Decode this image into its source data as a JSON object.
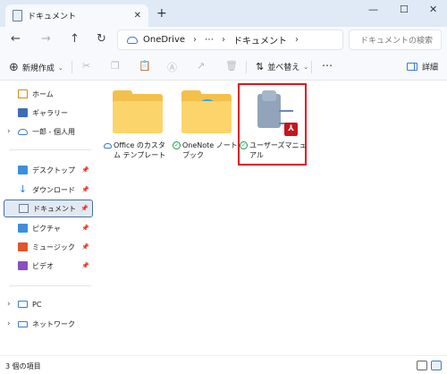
{
  "window": {
    "tab_title": "ドキュメント",
    "tab_close": "✕",
    "new_tab": "+",
    "minimize": "—",
    "maximize": "☐",
    "close": "✕"
  },
  "nav": {
    "back": "←",
    "forward": "→",
    "up": "↑",
    "refresh": "↻",
    "address": {
      "root": "OneDrive",
      "ellipsis": "⋯",
      "folder": "ドキュメント",
      "sep": "›"
    },
    "search_placeholder": "ドキュメントの検索"
  },
  "toolbar": {
    "new_label": "新規作成",
    "new_plus": "⊕",
    "sort_label": "並べ替え",
    "sort_icon": "⇅",
    "more": "⋯",
    "details_label": "詳細",
    "chevron": "⌄",
    "icons": [
      "cut-icon",
      "copy-icon",
      "paste-icon",
      "rename-icon",
      "share-icon",
      "delete-icon"
    ],
    "icon_glyphs": [
      "✂",
      "❐",
      "📋",
      "Ⓐ",
      "↗",
      "🗑"
    ]
  },
  "sidebar": {
    "pin": "📌",
    "caret": "›",
    "items": [
      {
        "label": "ホーム",
        "icon": "home-icon"
      },
      {
        "label": "ギャラリー",
        "icon": "gallery-icon"
      },
      {
        "label": "一郎 - 個人用",
        "icon": "onedrive-icon"
      },
      {
        "label": "デスクトップ",
        "icon": "desktop-icon"
      },
      {
        "label": "ダウンロード",
        "icon": "download-icon"
      },
      {
        "label": "ドキュメント",
        "icon": "documents-icon"
      },
      {
        "label": "ピクチャ",
        "icon": "pictures-icon"
      },
      {
        "label": "ミュージック",
        "icon": "music-icon"
      },
      {
        "label": "ビデオ",
        "icon": "videos-icon"
      },
      {
        "label": "PC",
        "icon": "pc-icon"
      },
      {
        "label": "ネットワーク",
        "icon": "network-icon"
      }
    ]
  },
  "files": [
    {
      "name": "Office のカスタム テンプレート",
      "status": "cloud"
    },
    {
      "name": "OneNote ノートブック",
      "status": "synced"
    },
    {
      "name": "ユーザーズマニュアル",
      "status": "synced",
      "badge": "PDF"
    }
  ],
  "statusbar": {
    "count": "3 個の項目"
  },
  "colors": {
    "accent": "#3c7bd4",
    "highlight": "#e3141b",
    "folder": "#f3c04a"
  }
}
